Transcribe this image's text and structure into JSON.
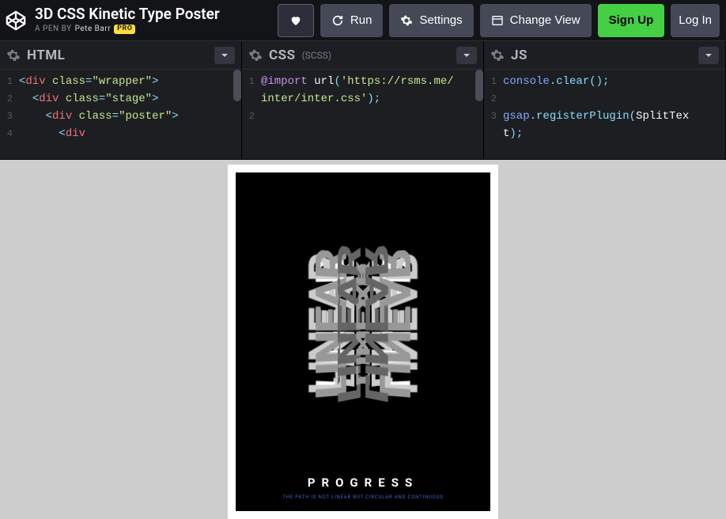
{
  "header": {
    "title": "3D CSS Kinetic Type Poster",
    "byline_prefix": "A PEN BY",
    "author": "Pete Barr",
    "pro_badge": "PRO"
  },
  "toolbar": {
    "run": "Run",
    "settings": "Settings",
    "change_view": "Change View",
    "sign_up": "Sign Up",
    "log_in": "Log In"
  },
  "panels": {
    "html": {
      "title": "HTML",
      "lines": [
        {
          "n": "1",
          "html": "<span class='t-punct'>&lt;</span><span class='t-tag'>div</span> <span class='t-attr'>class</span><span class='t-punct'>=</span><span class='t-str'>\"wrapper\"</span><span class='t-punct'>&gt;</span>"
        },
        {
          "n": "2",
          "html": "&nbsp;&nbsp;<span class='t-punct'>&lt;</span><span class='t-tag'>div</span> <span class='t-attr'>class</span><span class='t-punct'>=</span><span class='t-str'>\"stage\"</span><span class='t-punct'>&gt;</span>"
        },
        {
          "n": "3",
          "html": "&nbsp;&nbsp;&nbsp;&nbsp;<span class='t-punct'>&lt;</span><span class='t-tag'>div</span> <span class='t-attr'>class</span><span class='t-punct'>=</span><span class='t-str'>\"poster\"</span><span class='t-punct'>&gt;</span>"
        },
        {
          "n": "4",
          "html": "&nbsp;&nbsp;&nbsp;&nbsp;&nbsp;&nbsp;<span class='t-punct'>&lt;</span><span class='t-tag'>div</span>"
        }
      ]
    },
    "css": {
      "title": "CSS",
      "sub": "(SCSS)",
      "lines": [
        {
          "n": "1",
          "html": "<span class='t-key'>@import</span> <span class='t-ident'>url</span><span class='t-punct'>(</span><span class='t-str'>'https://rsms.me/inter/inter.css'</span><span class='t-punct'>)</span><span class='t-punct'>;</span>"
        },
        {
          "n": "2",
          "html": ""
        }
      ]
    },
    "js": {
      "title": "JS",
      "lines": [
        {
          "n": "1",
          "html": "<span class='t-obj'>console</span><span class='t-punct'>.</span><span class='t-fn'>clear</span><span class='t-punct'>(</span><span class='t-punct'>)</span><span class='t-punct'>;</span>"
        },
        {
          "n": "2",
          "html": ""
        },
        {
          "n": "3",
          "html": "<span class='t-obj'>gsap</span><span class='t-punct'>.</span><span class='t-fn'>registerPlugin</span><span class='t-punct'>(</span><span class='t-ident'>SplitText</span><span class='t-punct'>)</span><span class='t-punct'>;</span>"
        }
      ]
    }
  },
  "poster": {
    "kinetic_word": "LINEAR",
    "label": "PROGRESS",
    "sub": "THE PATH IS NOT LINEAR BUT CIRCULAR AND CONTINUOUS"
  }
}
